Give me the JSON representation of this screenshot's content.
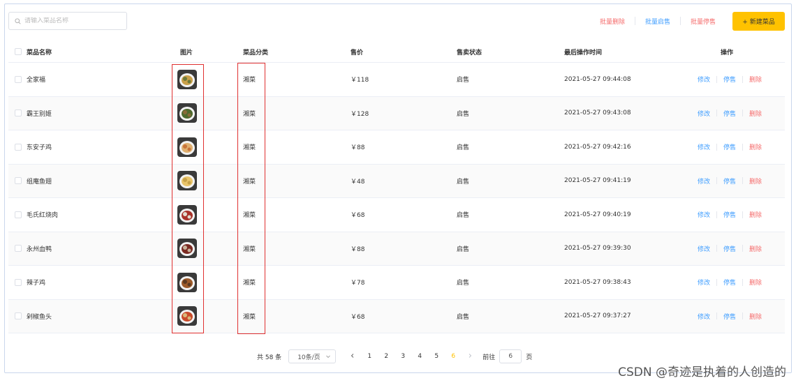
{
  "search": {
    "placeholder": "请输入菜品名称"
  },
  "toolbar": {
    "batch_delete": "批量删除",
    "batch_enable": "批量启售",
    "batch_disable": "批量停售",
    "new_dish": "+ 新建菜品"
  },
  "table": {
    "headers": [
      "菜品名称",
      "图片",
      "菜品分类",
      "售价",
      "售卖状态",
      "最后操作时间",
      "操作"
    ],
    "rows": [
      {
        "name": "全家福",
        "image": "dish-photo",
        "category": "湘菜",
        "price": "￥118",
        "status": "启售",
        "time": "2021-05-27 09:44:08",
        "img_colors": [
          "#c9a04a",
          "#6d7a3a"
        ]
      },
      {
        "name": "霸王别姬",
        "image": "dish-photo",
        "category": "湘菜",
        "price": "￥128",
        "status": "启售",
        "time": "2021-05-27 09:43:08",
        "img_colors": [
          "#4f6a2e",
          "#8a6a3a"
        ]
      },
      {
        "name": "东安子鸡",
        "image": "dish-photo",
        "category": "湘菜",
        "price": "￥88",
        "status": "启售",
        "time": "2021-05-27 09:42:16",
        "img_colors": [
          "#e0b070",
          "#c8743a"
        ]
      },
      {
        "name": "组庵鱼翅",
        "image": "dish-photo",
        "category": "湘菜",
        "price": "￥48",
        "status": "启售",
        "time": "2021-05-27 09:41:19",
        "img_colors": [
          "#e9c46a",
          "#c7a24a"
        ]
      },
      {
        "name": "毛氏红烧肉",
        "image": "dish-photo",
        "category": "湘菜",
        "price": "￥68",
        "status": "启售",
        "time": "2021-05-27 09:40:19",
        "img_colors": [
          "#a8322a",
          "#e2dccf"
        ]
      },
      {
        "name": "永州血鸭",
        "image": "dish-photo",
        "category": "湘菜",
        "price": "￥88",
        "status": "启售",
        "time": "2021-05-27 09:39:30",
        "img_colors": [
          "#7a2a22",
          "#c9b39a"
        ]
      },
      {
        "name": "辣子鸡",
        "image": "dish-photo",
        "category": "湘菜",
        "price": "￥78",
        "status": "启售",
        "time": "2021-05-27 09:38:43",
        "img_colors": [
          "#9c5a2a",
          "#5a3a22"
        ]
      },
      {
        "name": "剁椒鱼头",
        "image": "dish-photo",
        "category": "湘菜",
        "price": "￥68",
        "status": "启售",
        "time": "2021-05-27 09:37:27",
        "img_colors": [
          "#c94a2a",
          "#d9b87a"
        ]
      }
    ],
    "actions": {
      "edit": "修改",
      "disable": "停售",
      "delete": "删除"
    }
  },
  "pagination": {
    "total": "共 58 条",
    "page_size": "10条/页",
    "pages": [
      "1",
      "2",
      "3",
      "4",
      "5",
      "6"
    ],
    "current_page": "6",
    "goto_label": "前往",
    "goto_value": "6",
    "page_suffix": "页"
  },
  "watermark": "CSDN @奇迹是执着的人创造的",
  "colors": {
    "accent": "#ffc200",
    "link_blue": "#409eff",
    "danger_red": "#f56c6c",
    "highlight_box": "#e03030"
  }
}
